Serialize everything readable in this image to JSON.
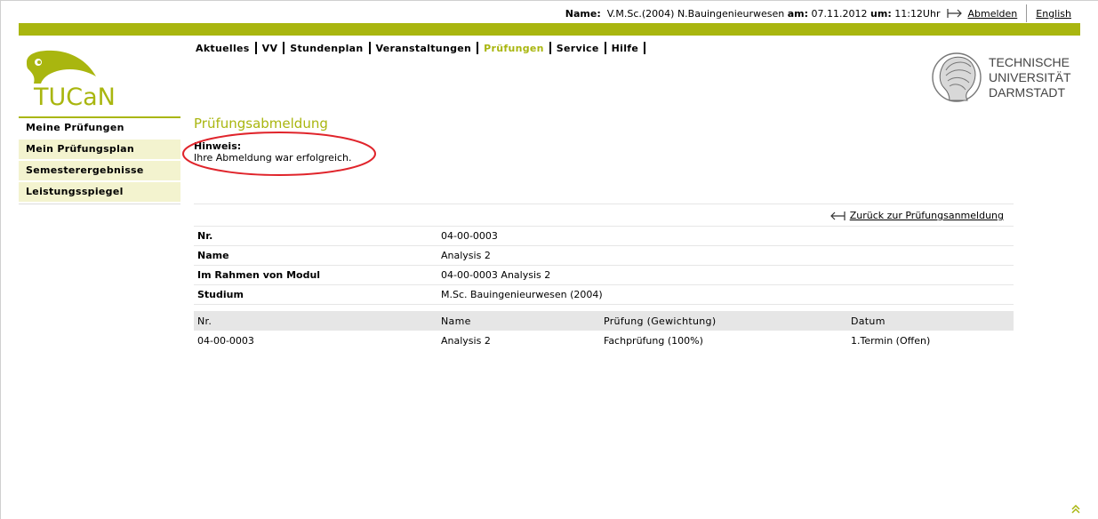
{
  "userbar": {
    "name_label": "Name",
    "name_value": "V.M.Sc.(2004) N.Bauingenieurwesen",
    "date_label": "am",
    "date_value": "07.11.2012",
    "time_label": "um",
    "time_value": "11:12Uhr",
    "logout": "Abmelden",
    "language": "English"
  },
  "mainnav": [
    "Aktuelles",
    "VV",
    "Stundenplan",
    "Veranstaltungen",
    "Prüfungen",
    "Service",
    "Hilfe"
  ],
  "logo": {
    "text": "TUCaN"
  },
  "university": {
    "line1": "TECHNISCHE",
    "line2": "UNIVERSITÄT",
    "line3": "DARMSTADT"
  },
  "leftnav": [
    "Meine Prüfungen",
    "Mein Prüfungsplan",
    "Semesterergebnisse",
    "Leistungsspiegel"
  ],
  "content": {
    "title": "Prüfungsabmeldung",
    "hint_label": "Hinweis:",
    "hint_text": "Ihre Abmeldung war erfolgreich.",
    "back_link": "Zurück zur Prüfungsanmeldung"
  },
  "info_rows": [
    {
      "key": "Nr.",
      "value": "04-00-0003"
    },
    {
      "key": "Name",
      "value": "Analysis 2"
    },
    {
      "key": "Im Rahmen von Modul",
      "value": "04-00-0003 Analysis 2"
    },
    {
      "key": "Studium",
      "value": "M.Sc. Bauingenieurwesen (2004)"
    }
  ],
  "exam_table": {
    "headers": [
      "Nr.",
      "Name",
      "Prüfung  (Gewichtung)",
      "Datum"
    ],
    "rows": [
      [
        "04-00-0003",
        "Analysis 2",
        "Fachprüfung (100%)",
        "1.Termin (Offen)"
      ]
    ]
  },
  "colors": {
    "accent": "#a9b60f",
    "highlight_circle": "#e0242b",
    "nav_bg": "#f3f3cf"
  }
}
